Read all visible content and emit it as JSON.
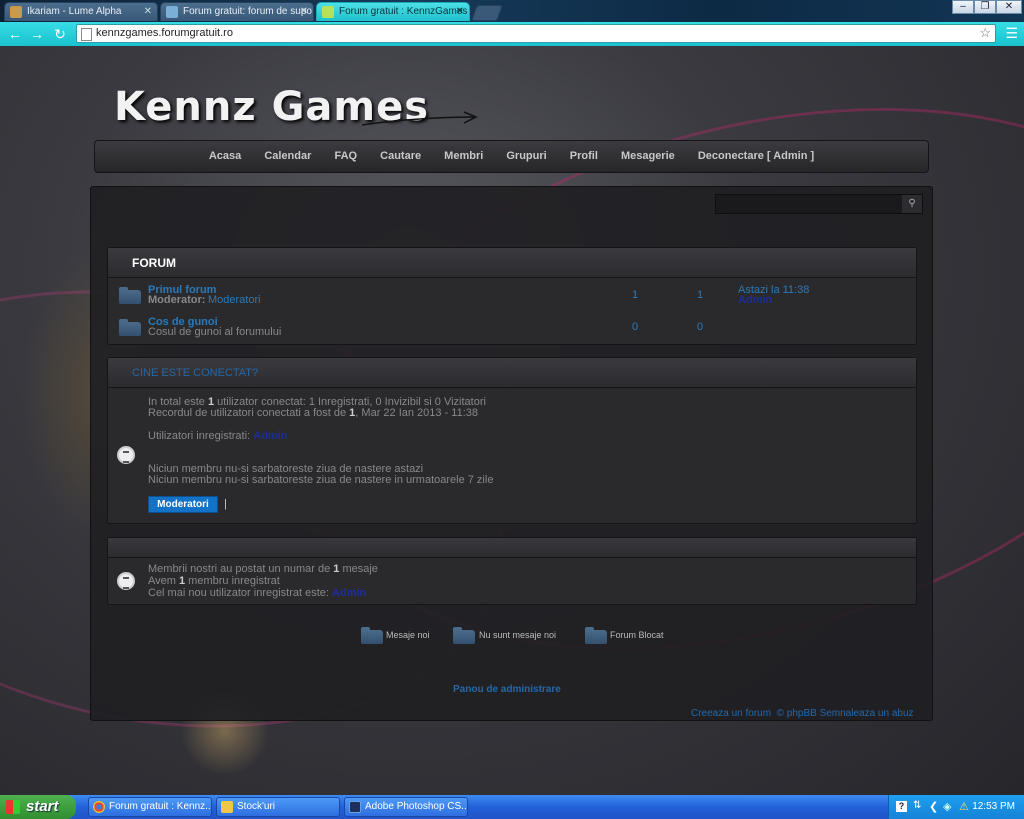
{
  "browser": {
    "tabs": [
      {
        "title": "Ikariam - Lume Alpha",
        "active": false
      },
      {
        "title": "Forum gratuit: forum de supo",
        "active": false
      },
      {
        "title": "Forum gratuit : KennzGames",
        "active": true
      }
    ],
    "url": "kennzgames.forumgratuit.ro",
    "window_controls": {
      "minimize": "–",
      "restore": "❐",
      "close": "✕"
    }
  },
  "site": {
    "logo": "Kennz Games",
    "nav": [
      "Acasa",
      "Calendar",
      "FAQ",
      "Cautare",
      "Membri",
      "Grupuri",
      "Profil",
      "Mesagerie",
      "Deconectare [ Admin ]"
    ]
  },
  "forum": {
    "header": "FORUM",
    "rows": [
      {
        "title": "Primul forum",
        "mod_label": "Moderator:",
        "mod_value": "Moderatori",
        "topics": "1",
        "posts": "1",
        "last_date": "Astazi la 11:38",
        "last_user": "Admin"
      },
      {
        "title": "Cos de gunoi",
        "desc": "Cosul de gunoi al forumului",
        "topics": "0",
        "posts": "0"
      }
    ]
  },
  "online": {
    "header": "CINE ESTE CONECTAT?",
    "line1": {
      "pre": "In total este ",
      "count": "1",
      "post": " utilizator conectat: 1 Inregistrati, 0 Invizibil si 0 Vizitatori"
    },
    "line2": {
      "pre": "Recordul de utilizatori conectati a fost de ",
      "count": "1",
      "post": ", Mar 22 Ian 2013 - 11:38"
    },
    "registered_label": "Utilizatori inregistrati: ",
    "registered_user": "Admin",
    "birthday_today": "Niciun membru nu-si sarbatoreste ziua de nastere astazi",
    "birthday_week": "Niciun membru nu-si sarbatoreste ziua de nastere in urmatoarele 7 zile",
    "moderators_button": "Moderatori",
    "separator": "|"
  },
  "stats": {
    "line1": {
      "pre": "Membrii nostri au postat un numar de ",
      "count": "1",
      "post": " mesaje"
    },
    "line2": {
      "pre": "Avem ",
      "count": "1",
      "post": " membru inregistrat"
    },
    "line3_label": "Cel mai nou utilizator inregistrat este: ",
    "line3_user": "Admin"
  },
  "legend": [
    "Mesaje noi",
    "Nu sunt mesaje noi",
    "Forum Blocat"
  ],
  "admin_link": "Panou de administrare",
  "footer": {
    "create": "Creeaza un forum",
    "copyright": "© phpBB",
    "report": "Semnaleaza un abuz"
  },
  "taskbar": {
    "start": "start",
    "tasks": [
      "Forum gratuit : Kennz...",
      "Stock'uri",
      "Adobe Photoshop CS..."
    ],
    "clock": "12:53 PM"
  },
  "colors": {
    "accent": "#1ec0cc",
    "link_blue": "#2a7ab8",
    "button_blue": "#1272c8"
  }
}
